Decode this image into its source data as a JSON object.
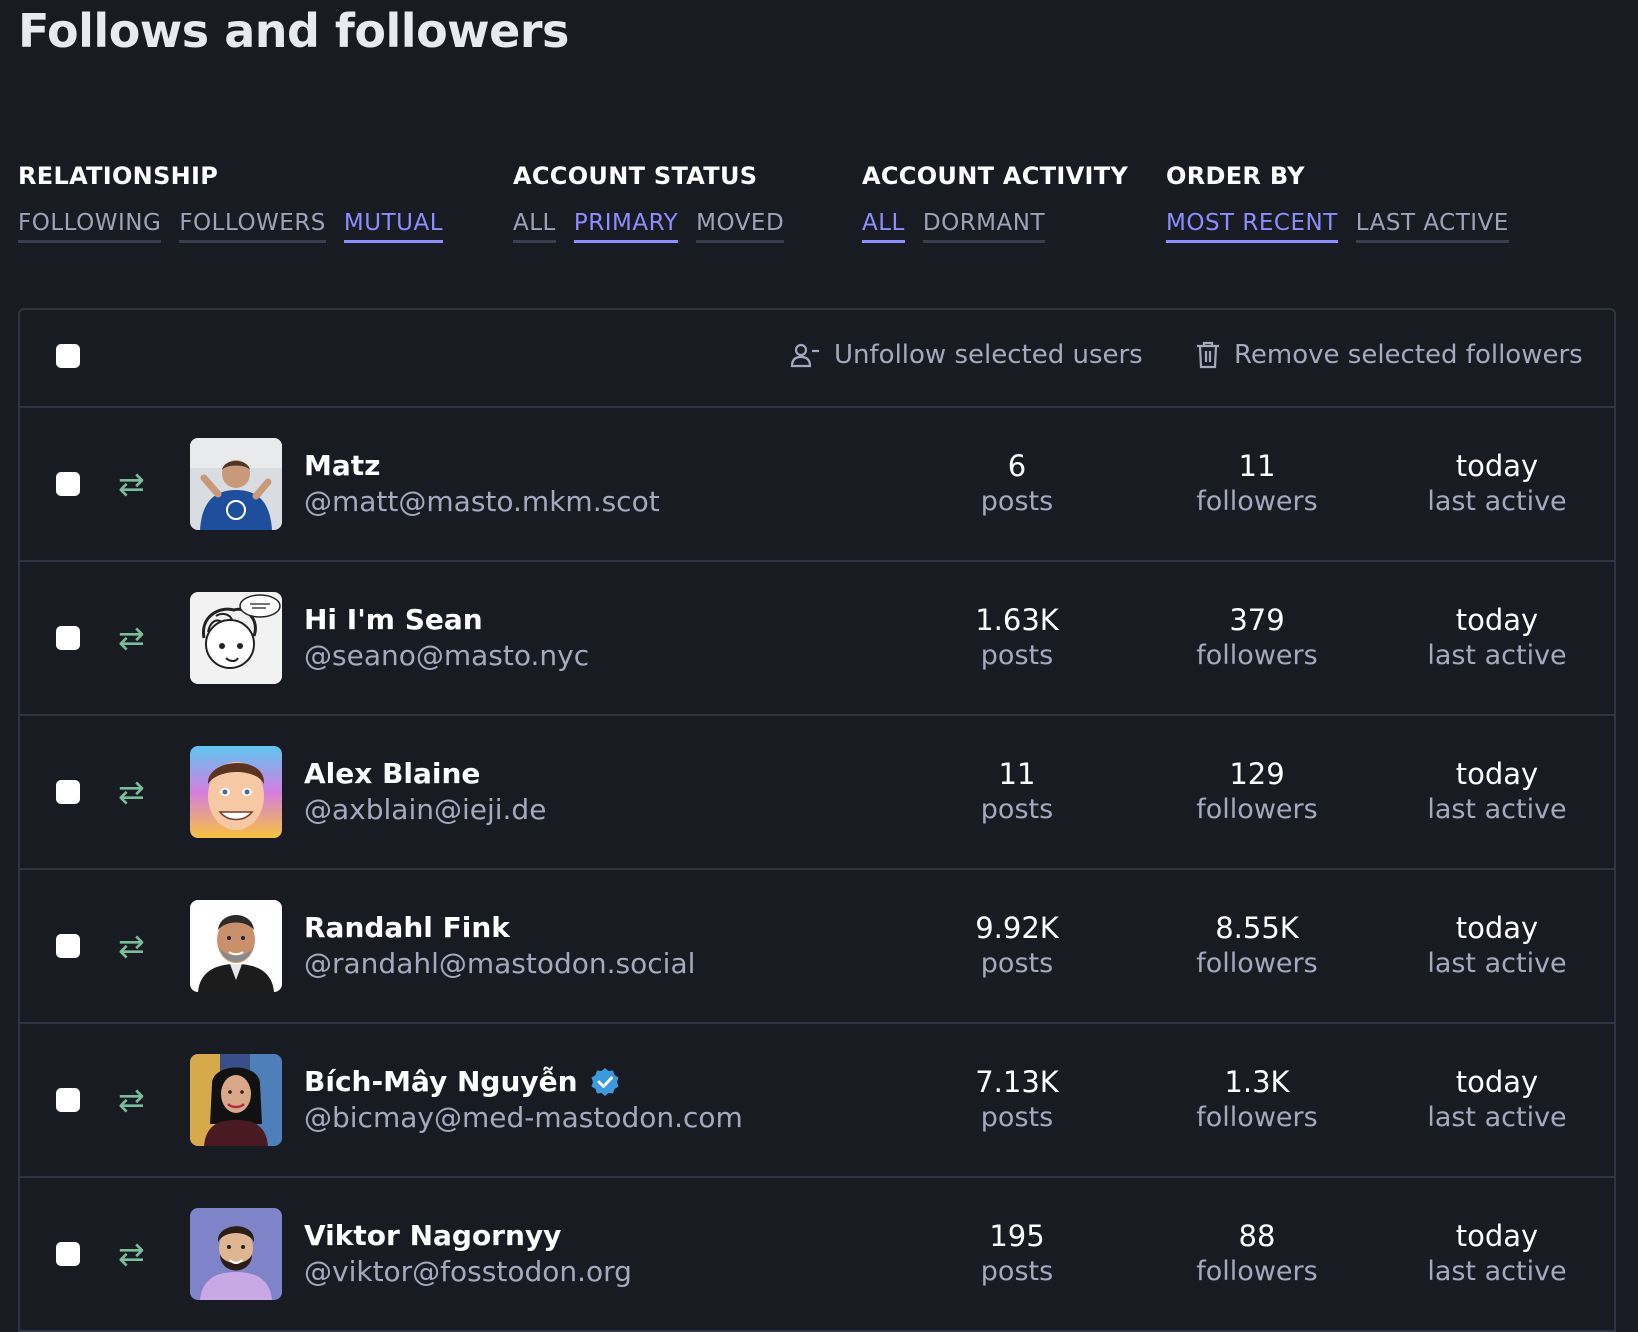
{
  "page_title": "Follows and followers",
  "filters": [
    {
      "heading": "RELATIONSHIP",
      "options": [
        {
          "label": "FOLLOWING",
          "active": false
        },
        {
          "label": "FOLLOWERS",
          "active": false
        },
        {
          "label": "MUTUAL",
          "active": true
        }
      ]
    },
    {
      "heading": "ACCOUNT STATUS",
      "options": [
        {
          "label": "ALL",
          "active": false
        },
        {
          "label": "PRIMARY",
          "active": true
        },
        {
          "label": "MOVED",
          "active": false
        }
      ]
    },
    {
      "heading": "ACCOUNT ACTIVITY",
      "options": [
        {
          "label": "ALL",
          "active": true
        },
        {
          "label": "DORMANT",
          "active": false
        }
      ]
    },
    {
      "heading": "ORDER BY",
      "options": [
        {
          "label": "MOST RECENT",
          "active": true
        },
        {
          "label": "LAST ACTIVE",
          "active": false
        }
      ]
    }
  ],
  "toolbar": {
    "unfollow_label": "Unfollow selected users",
    "remove_label": "Remove selected followers"
  },
  "accounts": [
    {
      "name": "Matz",
      "handle": "@matt@masto.mkm.scot",
      "posts": "6",
      "followers": "11",
      "last_active": "today",
      "verified": false
    },
    {
      "name": "Hi I'm Sean",
      "handle": "@seano@masto.nyc",
      "posts": "1.63K",
      "followers": "379",
      "last_active": "today",
      "verified": false
    },
    {
      "name": "Alex Blaine",
      "handle": "@axblain@ieji.de",
      "posts": "11",
      "followers": "129",
      "last_active": "today",
      "verified": false
    },
    {
      "name": "Randahl Fink",
      "handle": "@randahl@mastodon.social",
      "posts": "9.92K",
      "followers": "8.55K",
      "last_active": "today",
      "verified": false
    },
    {
      "name": "Bích-Mây Nguyễn",
      "handle": "@bicmay@med-mastodon.com",
      "posts": "7.13K",
      "followers": "1.3K",
      "last_active": "today",
      "verified": true
    },
    {
      "name": "Viktor Nagornyy",
      "handle": "@viktor@fosstodon.org",
      "posts": "195",
      "followers": "88",
      "last_active": "today",
      "verified": false
    }
  ],
  "stat_labels": {
    "posts": "posts",
    "followers": "followers",
    "last_active": "last active"
  },
  "colors": {
    "accent": "#8c8dff",
    "background": "#191b22",
    "mutual_icon": "#79bd9a",
    "verified": "#3c99dc"
  },
  "icons": {
    "mutual": "arrows-exchange-icon",
    "unfollow": "user-minus-icon",
    "remove": "trash-icon",
    "verified": "verified-badge-icon"
  }
}
